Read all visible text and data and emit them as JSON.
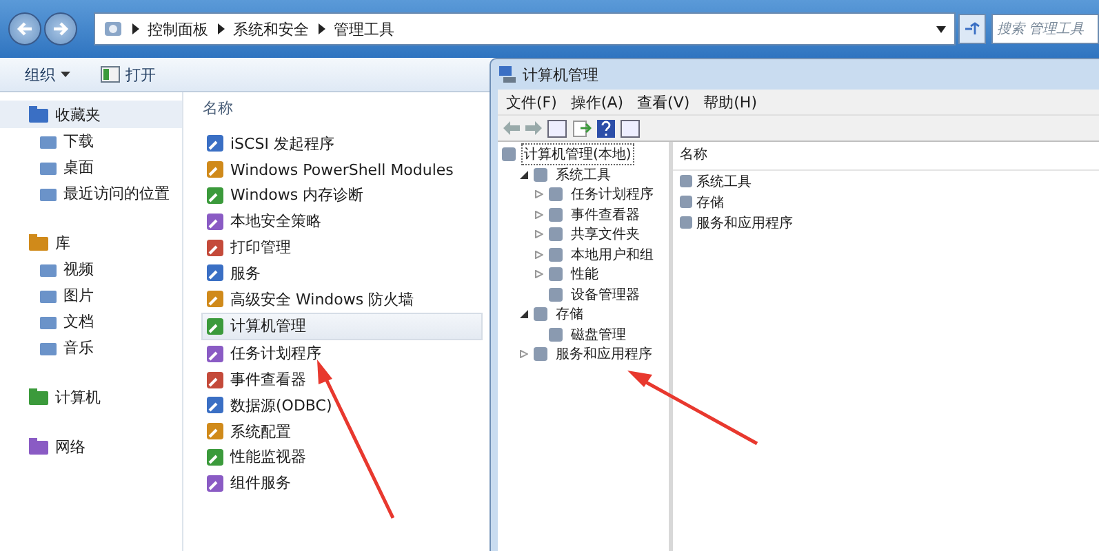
{
  "explorer": {
    "breadcrumb": [
      "控制面板",
      "系统和安全",
      "管理工具"
    ],
    "search": {
      "placeholder": "搜索 管理工具"
    },
    "toolbar": [
      {
        "label": "组织",
        "kind": "menu"
      },
      {
        "label": "打开",
        "kind": "open"
      }
    ],
    "nav_groups": [
      {
        "label": "收藏夹",
        "selected": true,
        "items": [
          "下载",
          "桌面",
          "最近访问的位置"
        ]
      },
      {
        "label": "库",
        "selected": false,
        "items": [
          "视频",
          "图片",
          "文档",
          "音乐"
        ]
      },
      {
        "label": "计算机",
        "selected": false
      },
      {
        "label": "网络",
        "selected": false
      }
    ],
    "column": "名称",
    "files": [
      {
        "name": "iSCSI 发起程序",
        "selected": false
      },
      {
        "name": "Windows PowerShell Modules",
        "selected": false
      },
      {
        "name": "Windows 内存诊断",
        "selected": false
      },
      {
        "name": "本地安全策略",
        "selected": false
      },
      {
        "name": "打印管理",
        "selected": false
      },
      {
        "name": "服务",
        "selected": false
      },
      {
        "name": "高级安全 Windows 防火墙",
        "selected": false
      },
      {
        "name": "计算机管理",
        "selected": true
      },
      {
        "name": "任务计划程序",
        "selected": false
      },
      {
        "name": "事件查看器",
        "selected": false
      },
      {
        "name": "数据源(ODBC)",
        "selected": false
      },
      {
        "name": "系统配置",
        "selected": false
      },
      {
        "name": "性能监视器",
        "selected": false
      },
      {
        "name": "组件服务",
        "selected": false
      }
    ]
  },
  "mmc": {
    "title": "计算机管理",
    "menu": [
      "文件(F)",
      "操作(A)",
      "查看(V)",
      "帮助(H)"
    ],
    "tree": [
      {
        "label": "计算机管理(本地)",
        "selected": true,
        "children": [
          {
            "label": "系统工具",
            "selected": false,
            "expanded": true,
            "children": [
              {
                "label": "任务计划程序",
                "selected": false,
                "expanded": false
              },
              {
                "label": "事件查看器",
                "selected": false,
                "expanded": false
              },
              {
                "label": "共享文件夹",
                "selected": false,
                "expanded": false
              },
              {
                "label": "本地用户和组",
                "selected": false,
                "expanded": false
              },
              {
                "label": "性能",
                "selected": false,
                "expanded": false
              },
              {
                "label": "设备管理器",
                "selected": false
              }
            ]
          },
          {
            "label": "存储",
            "selected": false,
            "expanded": true,
            "children": [
              {
                "label": "磁盘管理",
                "selected": false
              }
            ]
          },
          {
            "label": "服务和应用程序",
            "selected": false,
            "expanded": false
          }
        ]
      }
    ],
    "column": "名称",
    "items": [
      "系统工具",
      "存储",
      "服务和应用程序"
    ]
  }
}
